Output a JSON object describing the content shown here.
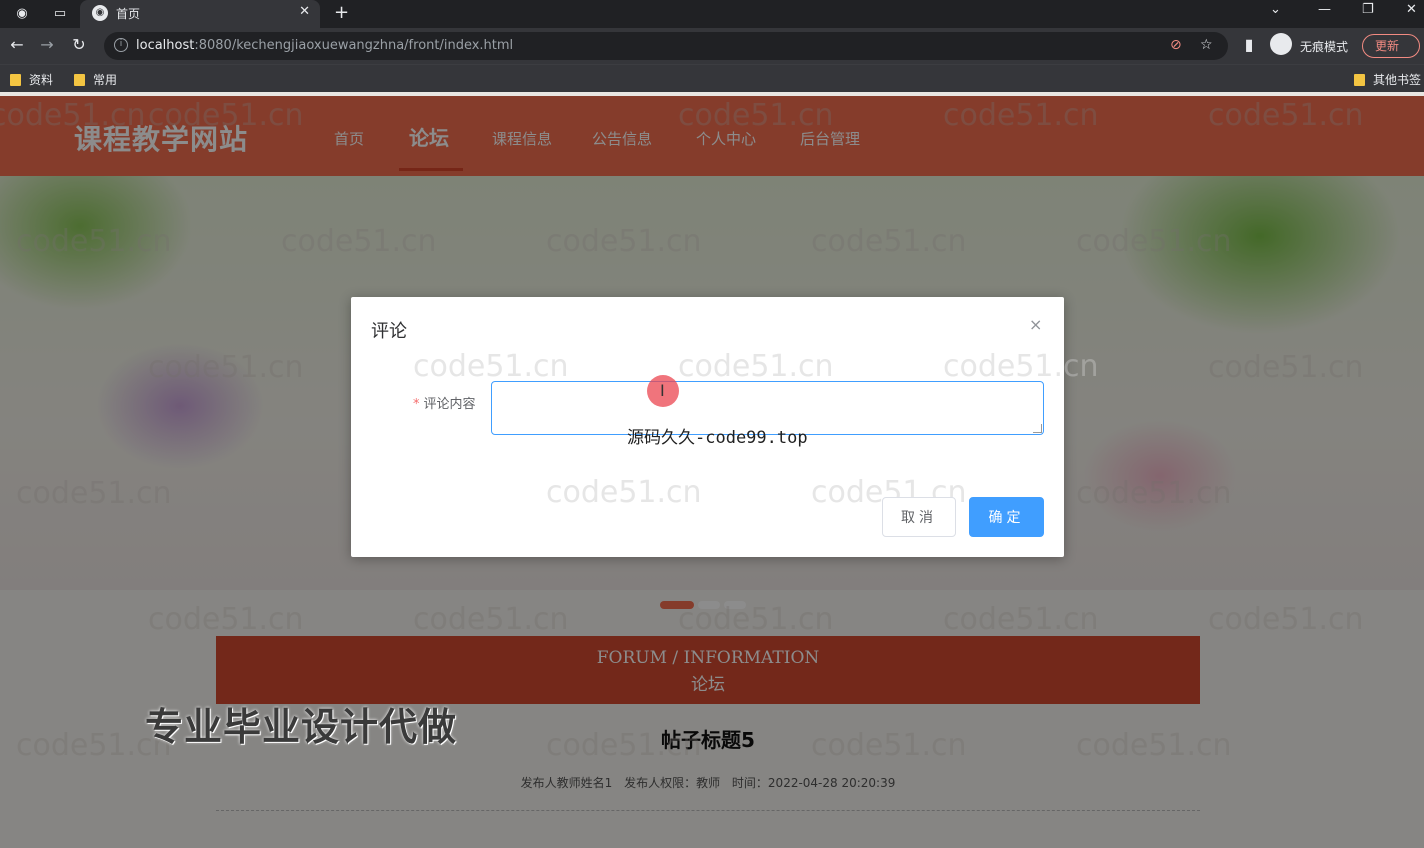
{
  "browser": {
    "tab_title": "首页",
    "url_host": "localhost",
    "url_rest": ":8080/kechengjiaoxuewangzhna/front/index.html",
    "incognito_label": "无痕模式",
    "update_label": "更新",
    "bookmarks": [
      "资料",
      "常用"
    ],
    "other_bookmarks": "其他书签"
  },
  "header": {
    "site_title": "课程教学网站",
    "nav": [
      "首页",
      "论坛",
      "课程信息",
      "公告信息",
      "个人中心",
      "后台管理"
    ],
    "active_index": 1
  },
  "section": {
    "en": "FORUM / INFORMATION",
    "zh": "论坛"
  },
  "post": {
    "title": "帖子标题5",
    "author": "发布人教师姓名1",
    "role": "发布人权限：教师",
    "time": "时间：2022-04-28 20:20:39"
  },
  "watermark": "code51.cn",
  "promo": "专业毕业设计代做",
  "dialog": {
    "title": "评论",
    "close": "×",
    "field_label": "评论内容",
    "required_mark": "*",
    "content_value": "",
    "overlay_text": "源码久久-code99.top",
    "cancel_label": "取消",
    "ok_label": "确定"
  },
  "colors": {
    "header_bg": "#f26d4f",
    "section_bg": "#d24a31",
    "primary_button": "#409eff"
  }
}
